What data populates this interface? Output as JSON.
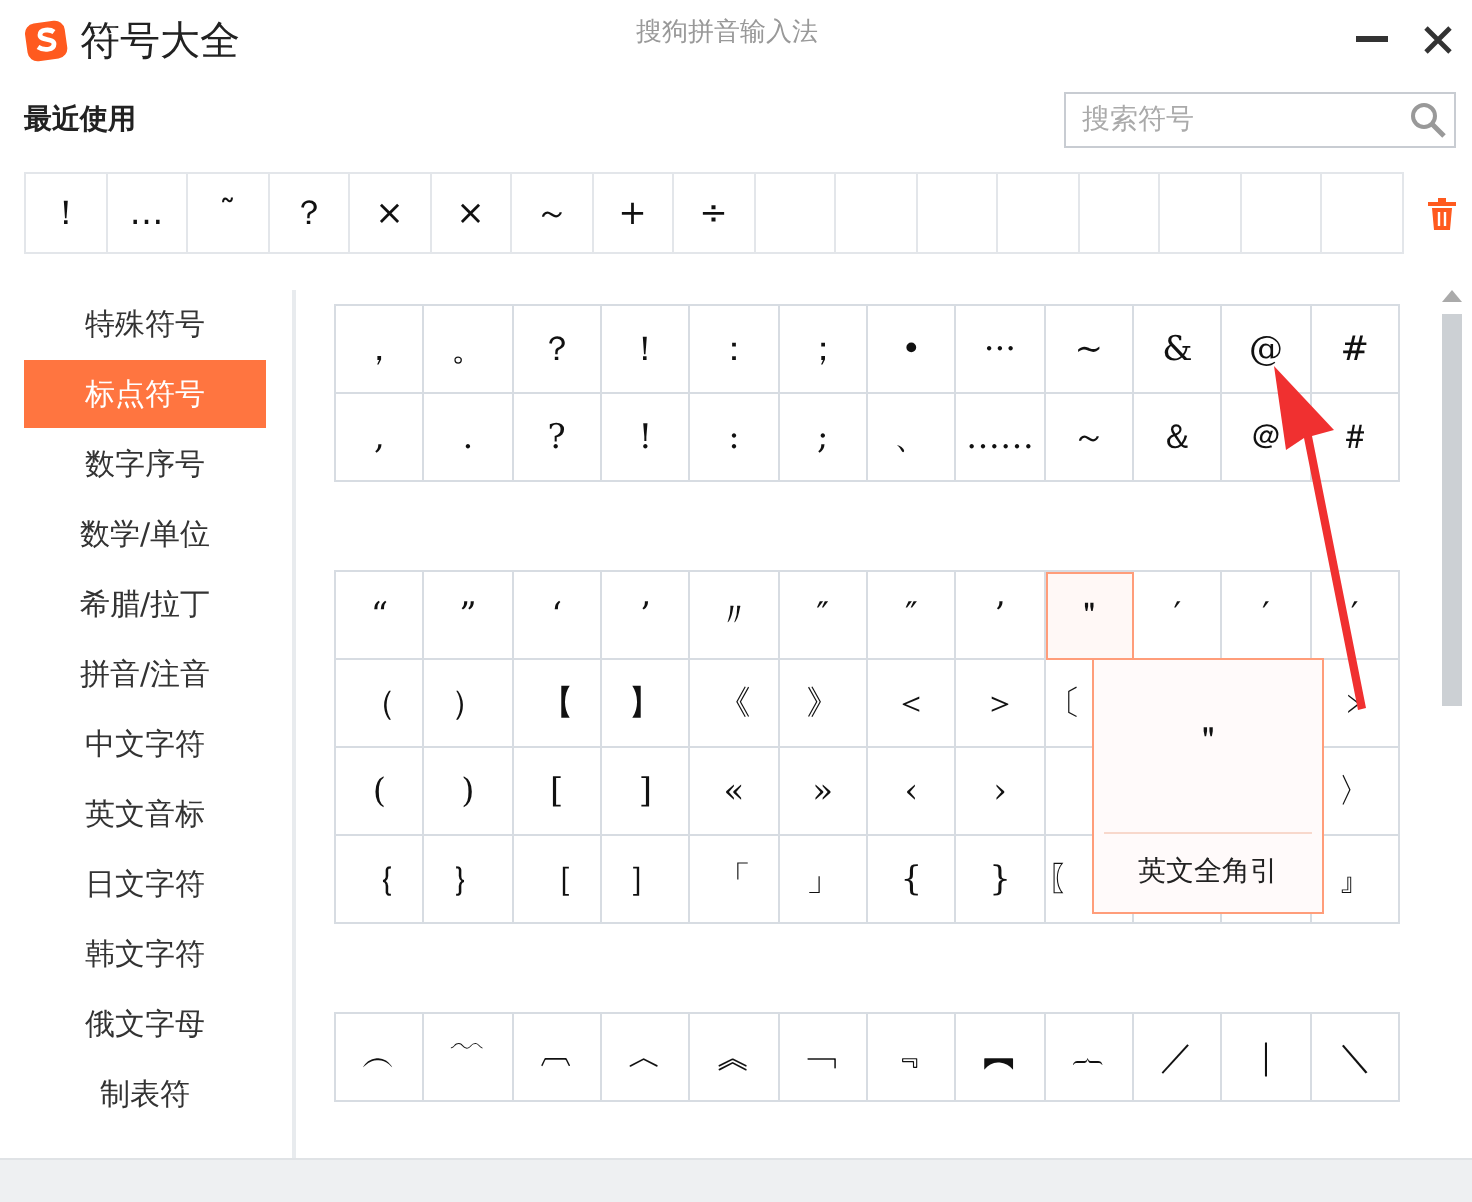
{
  "window": {
    "title": "符号大全",
    "subtitle": "搜狗拼音输入法"
  },
  "recent": {
    "title": "最近使用",
    "symbols": [
      "！",
      "…",
      "˜",
      "？",
      "×",
      "×",
      "～",
      "+",
      "÷"
    ]
  },
  "search": {
    "placeholder": "搜索符号"
  },
  "sidebar": {
    "items": [
      {
        "label": "特殊符号",
        "selected": false
      },
      {
        "label": "标点符号",
        "selected": true
      },
      {
        "label": "数字序号",
        "selected": false
      },
      {
        "label": "数学/单位",
        "selected": false
      },
      {
        "label": "希腊/拉丁",
        "selected": false
      },
      {
        "label": "拼音/注音",
        "selected": false
      },
      {
        "label": "中文字符",
        "selected": false
      },
      {
        "label": "英文音标",
        "selected": false
      },
      {
        "label": "日文字符",
        "selected": false
      },
      {
        "label": "韩文字符",
        "selected": false
      },
      {
        "label": "俄文字母",
        "selected": false
      },
      {
        "label": "制表符",
        "selected": false
      }
    ]
  },
  "groups": [
    {
      "rows": [
        [
          {
            "symbol": "，",
            "selected": false
          },
          {
            "symbol": "。",
            "selected": false
          },
          {
            "symbol": "？",
            "selected": false
          },
          {
            "symbol": "！",
            "selected": false
          },
          {
            "symbol": "：",
            "selected": false
          },
          {
            "symbol": "；",
            "selected": false
          },
          {
            "symbol": "•",
            "selected": false
          },
          {
            "symbol": "···",
            "selected": false
          },
          {
            "symbol": "~",
            "selected": false
          },
          {
            "symbol": "&",
            "selected": false
          },
          {
            "symbol": "@",
            "selected": false
          },
          {
            "symbol": "#",
            "selected": false
          }
        ],
        [
          {
            "symbol": ",",
            "selected": false
          },
          {
            "symbol": ".",
            "selected": false
          },
          {
            "symbol": "?",
            "selected": false
          },
          {
            "symbol": "!",
            "selected": false
          },
          {
            "symbol": ":",
            "selected": false
          },
          {
            "symbol": ";",
            "selected": false
          },
          {
            "symbol": "、",
            "selected": false
          },
          {
            "symbol": "……",
            "selected": false
          },
          {
            "symbol": "～",
            "selected": false
          },
          {
            "symbol": "＆",
            "selected": false
          },
          {
            "symbol": "＠",
            "selected": false
          },
          {
            "symbol": "＃",
            "selected": false
          }
        ]
      ]
    },
    {
      "rows": [
        [
          {
            "symbol": "“",
            "selected": false
          },
          {
            "symbol": "”",
            "selected": false
          },
          {
            "symbol": "‘",
            "selected": false
          },
          {
            "symbol": "’",
            "selected": false
          },
          {
            "symbol": "〃",
            "selected": false
          },
          {
            "symbol": "″",
            "selected": false
          },
          {
            "symbol": "″",
            "selected": false
          },
          {
            "symbol": "’",
            "selected": false
          },
          {
            "symbol": "＂",
            "selected": true
          },
          {
            "symbol": "′",
            "selected": false
          },
          {
            "symbol": "′",
            "selected": false
          },
          {
            "symbol": "′",
            "selected": false
          }
        ],
        [
          {
            "symbol": "（",
            "selected": false
          },
          {
            "symbol": "）",
            "selected": false
          },
          {
            "symbol": "【",
            "selected": false
          },
          {
            "symbol": "】",
            "selected": false
          },
          {
            "symbol": "《",
            "selected": false
          },
          {
            "symbol": "》",
            "selected": false
          },
          {
            "symbol": "＜",
            "selected": false
          },
          {
            "symbol": "＞",
            "selected": false
          },
          {
            "symbol": "〔",
            "selected": false
          },
          null,
          null,
          {
            "symbol": "﹥",
            "selected": false
          }
        ],
        [
          {
            "symbol": "(",
            "selected": false
          },
          {
            "symbol": ")",
            "selected": false
          },
          {
            "symbol": "[",
            "selected": false
          },
          {
            "symbol": "]",
            "selected": false
          },
          {
            "symbol": "«",
            "selected": false
          },
          {
            "symbol": "»",
            "selected": false
          },
          {
            "symbol": "‹",
            "selected": false
          },
          {
            "symbol": "›",
            "selected": false
          },
          null,
          null,
          null,
          {
            "symbol": "〉",
            "selected": false
          }
        ],
        [
          {
            "symbol": "｛",
            "selected": false
          },
          {
            "symbol": "｝",
            "selected": false
          },
          {
            "symbol": "［",
            "selected": false
          },
          {
            "symbol": "］",
            "selected": false
          },
          {
            "symbol": "「",
            "selected": false
          },
          {
            "symbol": "」",
            "selected": false
          },
          {
            "symbol": "{",
            "selected": false
          },
          {
            "symbol": "}",
            "selected": false
          },
          {
            "symbol": "〖",
            "selected": false
          },
          null,
          null,
          {
            "symbol": "』",
            "selected": false
          }
        ]
      ],
      "tooltip": {
        "symbol": "＂",
        "label": "英文全角引"
      }
    },
    {
      "rows": [
        [
          {
            "symbol": "︵",
            "selected": false
          },
          {
            "symbol": "﹋",
            "selected": false
          },
          {
            "symbol": "︹",
            "selected": false
          },
          {
            "symbol": "︿",
            "selected": false
          },
          {
            "symbol": "︽",
            "selected": false
          },
          {
            "symbol": "﹁",
            "selected": false
          },
          {
            "symbol": "﹃",
            "selected": false
          },
          {
            "symbol": "︻",
            "selected": false
          },
          {
            "symbol": "︷",
            "selected": false
          },
          {
            "symbol": "／",
            "selected": false
          },
          {
            "symbol": "｜",
            "selected": false
          },
          {
            "symbol": "＼",
            "selected": false
          }
        ]
      ]
    }
  ],
  "annotations": [
    {
      "kind": "arrow"
    }
  ]
}
